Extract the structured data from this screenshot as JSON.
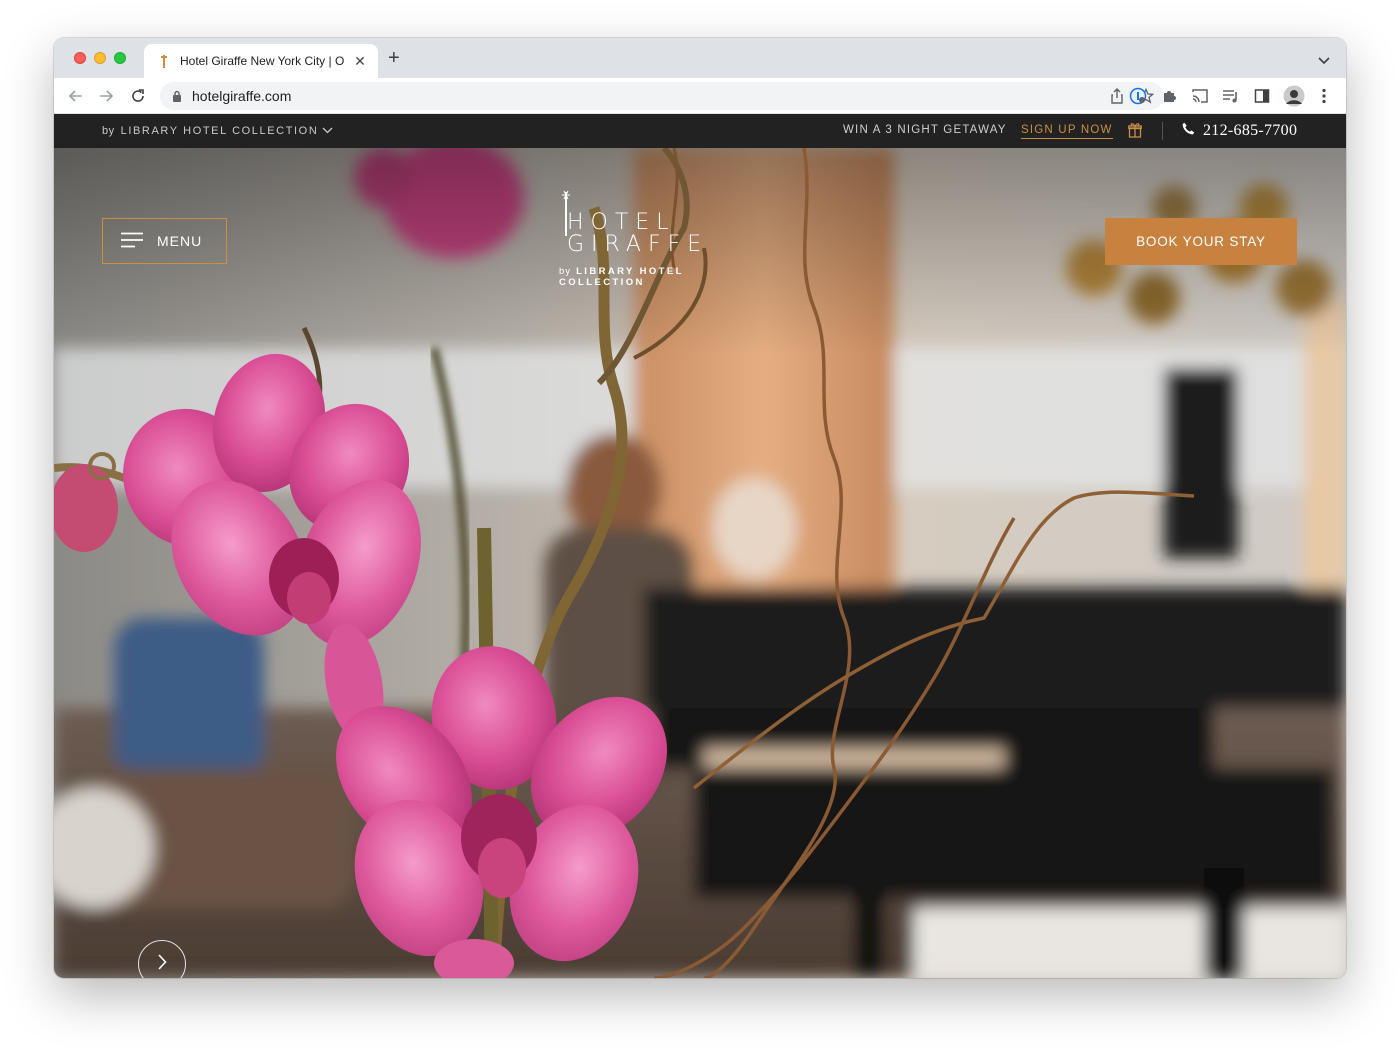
{
  "browser": {
    "tab_title": "Hotel Giraffe New York City | O",
    "tab_close_glyph": "✕",
    "new_tab_glyph": "+",
    "url": "hotelgiraffe.com"
  },
  "topbar": {
    "collection_prefix": "by",
    "collection_label": "LIBRARY HOTEL COLLECTION",
    "promo_text": "WIN A 3 NIGHT GETAWAY",
    "signup_label": "SIGN UP NOW",
    "phone": "212-685-7700",
    "accent_color": "#c98f45"
  },
  "hero": {
    "menu_label": "MENU",
    "book_label": "BOOK YOUR STAY",
    "logo_main": "HOTEL GIRAFFE",
    "logo_sub_prefix": "by",
    "logo_sub": "LIBRARY HOTEL COLLECTION",
    "button_color": "#c7823f"
  }
}
